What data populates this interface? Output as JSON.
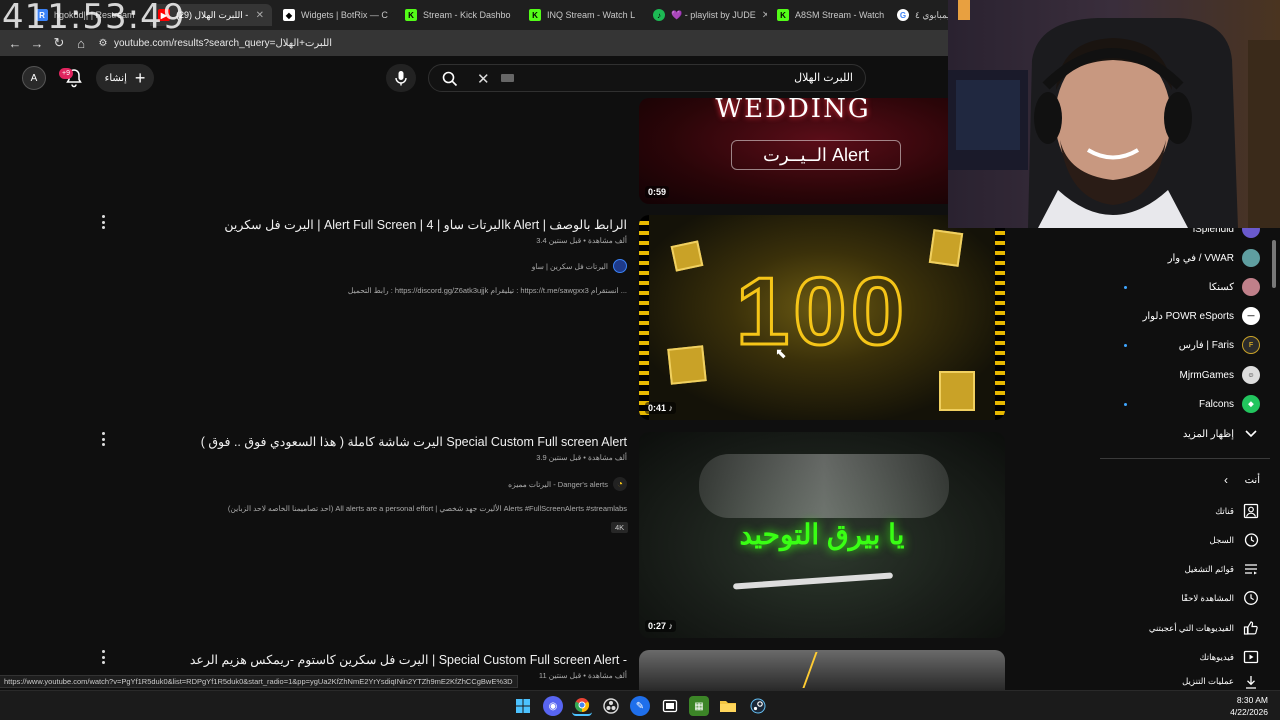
{
  "browser": {
    "clock_overlay": "411:53:49",
    "tabs": [
      {
        "label": "hgokdd|| | Restream",
        "fav_color": "#3b82f6",
        "fav_text": "R"
      },
      {
        "label": "(29) اللبرت الهلال -",
        "fav_color": "#ff0000",
        "fav_text": "▶",
        "active": true
      },
      {
        "label": "Widgets | BotRix — C",
        "fav_color": "#ffffff",
        "fav_text": "◆"
      },
      {
        "label": "Stream - Kick Dashbo",
        "fav_color": "#53fc18",
        "fav_text": "K"
      },
      {
        "label": "INQ Stream - Watch L",
        "fav_color": "#53fc18",
        "fav_text": "K"
      },
      {
        "label": "💜 - playlist by JUDE",
        "fav_color": "#1db954",
        "fav_text": "♪"
      },
      {
        "label": "A8SM Stream - Watch",
        "fav_color": "#53fc18",
        "fav_text": "K"
      },
      {
        "label": "زيمبابوي ٤",
        "fav_color": "#ffffff",
        "fav_text": "G"
      }
    ],
    "url": "youtube.com/results?search_query=اللبرت+الهلال"
  },
  "header": {
    "search_value": "اللبرت الهلال",
    "create_label": "إنشاء",
    "notif_count": "+9"
  },
  "videos": [
    {
      "duration": "0:59",
      "thumb_title": "WEDDING",
      "thumb_sub": "الــيــرت Alert"
    },
    {
      "title": "اليرت فل سكرين | Alert Full Screen | اليرتات ساو | 4k Alert | الرابط بالوصف",
      "meta": "3.4 ألف مشاهدة • قبل سنتين",
      "channel": "اليرتات فل سكرين | ساو",
      "desc": "رابط التحميل : https://discord.gg/Z6atk3ujjk تيليقرام : https://t.me/sawgxx3 انستقرام ...",
      "duration": "0:41",
      "thumb_text": "100"
    },
    {
      "title": "اليرت شاشة كاملة ( هذا السعودي فوق .. فوق ) Special Custom Full screen Alert",
      "meta": "3.9 ألف مشاهدة • قبل سنتين",
      "channel": "اليرتات مميزه - Danger's alerts",
      "desc": "(احد تصاميمنا الخاصه لاحد الزباين) All alerts are a personal effort | الأليرت جهد شخصي Alerts #FullScreenAlerts #streamlabs",
      "tag": "4K",
      "duration": "0:27",
      "thumb_text": "يا بيرق التوحيد"
    },
    {
      "title": "اليرت فل سكرين كاستوم -ريمكس هزيم الرعد | Special Custom Full screen Alert -",
      "meta": "11 ألف مشاهدة • قبل سنتين"
    }
  ],
  "sidebar": {
    "subscriptions": [
      {
        "label": "iSplendid",
        "color": "#6a5acd",
        "live": false
      },
      {
        "label": "في وار / VWAR",
        "color": "#5f9ea0",
        "live": false
      },
      {
        "label": "كسنكا",
        "color": "#c0808a",
        "live": true
      },
      {
        "label": "دلوار POWR eSports",
        "color": "#ffffff",
        "live": false
      },
      {
        "label": "فارس | Faris",
        "color": "#2b2b2b",
        "live": true
      },
      {
        "label": "MjrmGames",
        "color": "#dddddd",
        "live": false
      },
      {
        "label": "Falcons",
        "color": "#22c55e",
        "live": true
      }
    ],
    "show_more": "إظهار المزيد",
    "you_header": "أنت",
    "you_items": [
      {
        "label": "قناتك",
        "icon": "user-square-icon"
      },
      {
        "label": "السجل",
        "icon": "history-icon"
      },
      {
        "label": "قوائم التشغيل",
        "icon": "playlist-icon"
      },
      {
        "label": "المشاهدة لاحقًا",
        "icon": "clock-icon"
      },
      {
        "label": "الفيديوهات التي أعجبتني",
        "icon": "thumb-up-icon"
      },
      {
        "label": "فيديوهاتك",
        "icon": "play-square-icon"
      },
      {
        "label": "عمليات التنزيل",
        "icon": "download-icon"
      }
    ]
  },
  "status_url": "https://www.youtube.com/watch?v=PgYf1R5duk0&list=RDPgYf1R5duk0&start_radio=1&pp=ygUa2KfZhNmE2YrYsdiqINin2YTZh9mE2KfZhCCgBwE%3D",
  "taskbar": {
    "time": "8:30 AM",
    "date": "4/22/2026"
  }
}
